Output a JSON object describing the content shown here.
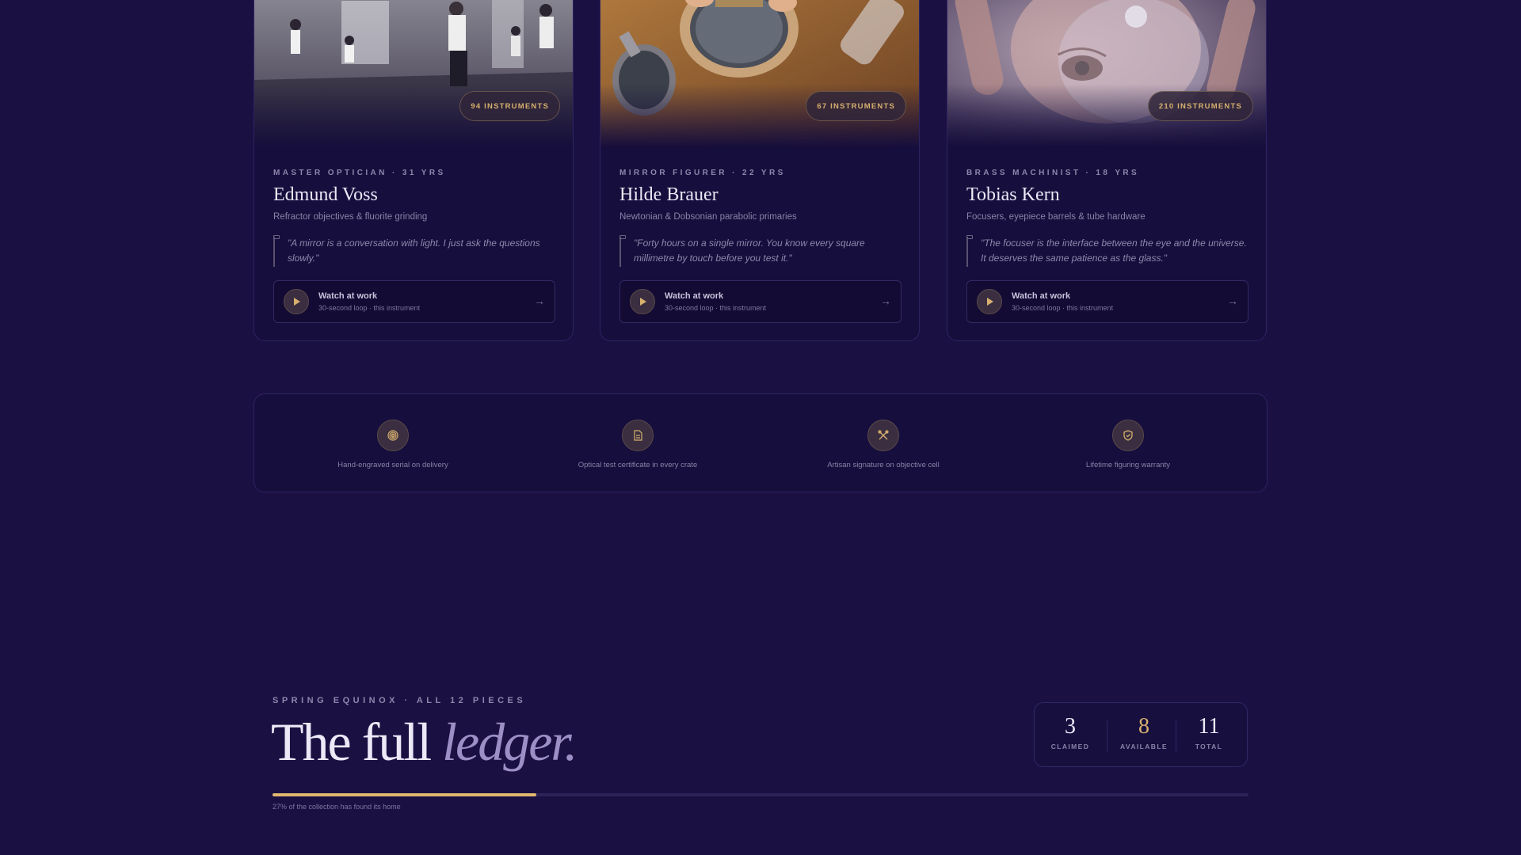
{
  "artisans": [
    {
      "badge": "94 INSTRUMENTS",
      "role": "MASTER OPTICIAN · 31 YRS",
      "name": "Edmund Voss",
      "specialty": "Refractor objectives & fluorite grinding",
      "quote": "\"A mirror is a conversation with light. I just ask the questions slowly.\"",
      "watch_title": "Watch at work",
      "watch_sub": "30-second loop · this instrument"
    },
    {
      "badge": "67 INSTRUMENTS",
      "role": "MIRROR FIGURER · 22 YRS",
      "name": "Hilde Brauer",
      "specialty": "Newtonian & Dobsonian parabolic primaries",
      "quote": "\"Forty hours on a single mirror. You know every square millimetre by touch before you test it.\"",
      "watch_title": "Watch at work",
      "watch_sub": "30-second loop · this instrument"
    },
    {
      "badge": "210 INSTRUMENTS",
      "role": "BRASS MACHINIST · 18 YRS",
      "name": "Tobias Kern",
      "specialty": "Focusers, eyepiece barrels & tube hardware",
      "quote": "\"The focuser is the interface between the eye and the universe. It deserves the same patience as the glass.\"",
      "watch_title": "Watch at work",
      "watch_sub": "30-second loop · this instrument"
    }
  ],
  "guarantees": [
    {
      "icon": "fingerprint-icon",
      "label": "Hand-engraved serial on delivery"
    },
    {
      "icon": "certificate-icon",
      "label": "Optical test certificate in every crate"
    },
    {
      "icon": "tools-icon",
      "label": "Artisan signature on objective cell"
    },
    {
      "icon": "shield-icon",
      "label": "Lifetime figuring warranty"
    }
  ],
  "ledger": {
    "eyebrow": "SPRING EQUINOX · ALL 12 PIECES",
    "title_main": "The full ",
    "title_em": "ledger.",
    "stats": [
      {
        "value": "3",
        "label": "CLAIMED"
      },
      {
        "value": "8",
        "label": "AVAILABLE"
      },
      {
        "value": "11",
        "label": "TOTAL"
      }
    ],
    "progress_fraction": 0.27,
    "progress_note": "27% of the collection has found its home"
  },
  "colors": {
    "accent": "#d7b06e",
    "background": "#1b1042",
    "card": "#160e3c"
  }
}
